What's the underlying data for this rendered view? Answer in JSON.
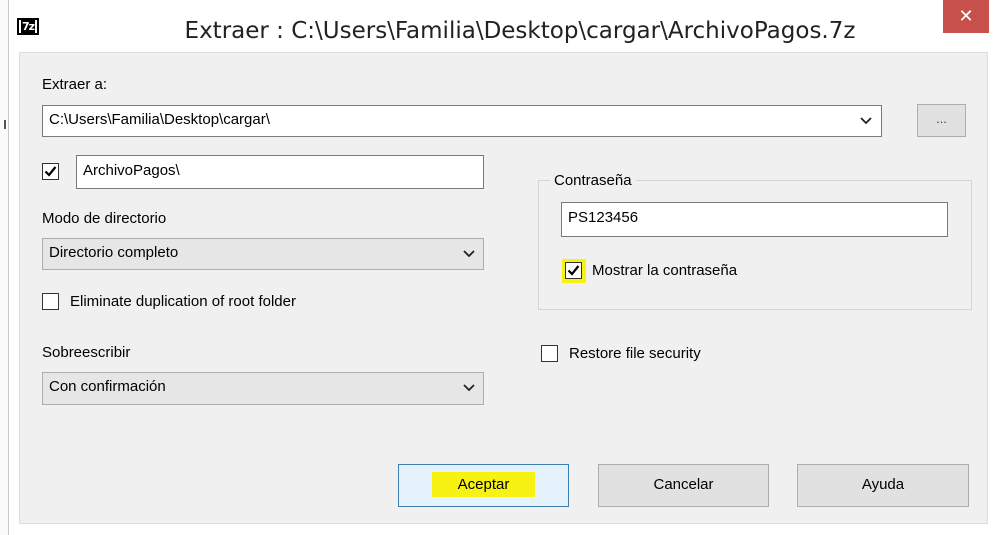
{
  "window": {
    "title": "Extraer : C:\\Users\\Familia\\Desktop\\cargar\\ArchivoPagos.7z",
    "app_icon_text": "7z",
    "close_glyph": "✕"
  },
  "extract_to": {
    "label": "Extraer a:",
    "path": "C:\\Users\\Familia\\Desktop\\cargar\\",
    "browse_label": "..."
  },
  "subfolder": {
    "checked": true,
    "value": "ArchivoPagos\\"
  },
  "path_mode": {
    "label": "Modo de directorio",
    "value": "Directorio completo"
  },
  "eliminate_duplication": {
    "label": "Eliminate duplication of root folder",
    "checked": false
  },
  "overwrite": {
    "label": "Sobreescribir",
    "value": "Con confirmación"
  },
  "password": {
    "group_label": "Contraseña",
    "value": "PS123456",
    "show_label": "Mostrar la contraseña",
    "show_checked": true
  },
  "restore_security": {
    "label": "Restore file security",
    "checked": false
  },
  "buttons": {
    "ok": "Aceptar",
    "cancel": "Cancelar",
    "help": "Ayuda"
  },
  "colors": {
    "highlight": "#f7f212",
    "close": "#c7504b",
    "default_button_border": "#3c7fb1"
  }
}
